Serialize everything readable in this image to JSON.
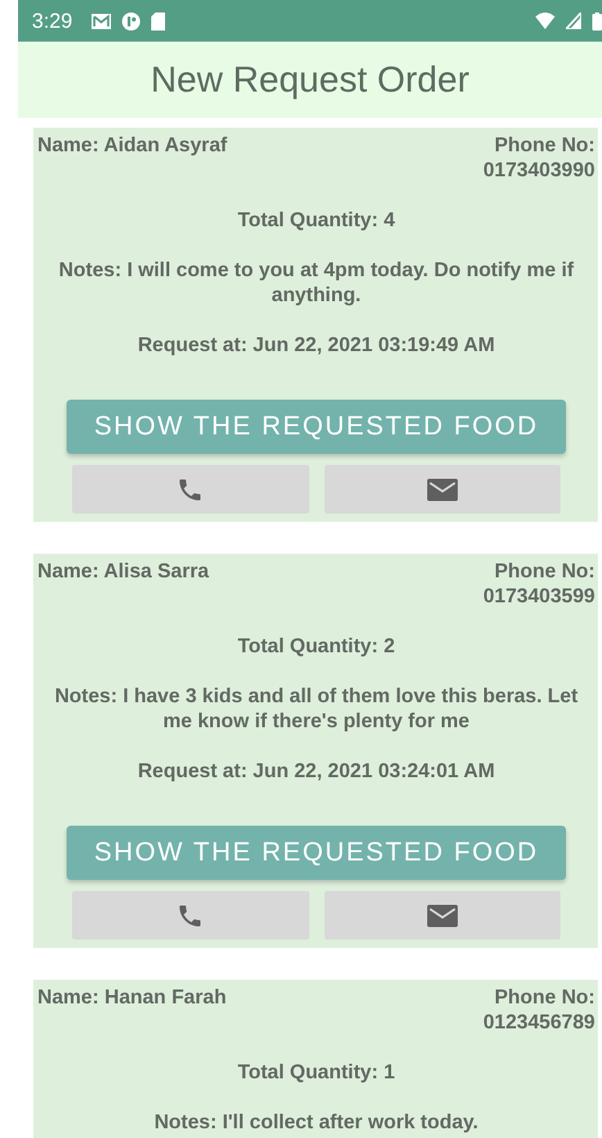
{
  "status_bar": {
    "time": "3:29"
  },
  "header": {
    "title": "New Request Order"
  },
  "requests": [
    {
      "name": "Name: Aidan Asyraf",
      "phone_label": "Phone No:",
      "phone": "0173403990",
      "quantity": "Total Quantity: 4",
      "notes": "Notes: I will come to you at 4pm today. Do notify me if anything.",
      "requested_at": "Request at: Jun 22, 2021 03:19:49 AM",
      "button": "SHOW THE REQUESTED FOOD"
    },
    {
      "name": "Name: Alisa Sarra",
      "phone_label": "Phone No:",
      "phone": "0173403599",
      "quantity": "Total Quantity: 2",
      "notes": "Notes: I have 3 kids and all of them love this beras. Let me know if there's plenty for me",
      "requested_at": "Request at: Jun 22, 2021 03:24:01 AM",
      "button": "SHOW THE REQUESTED FOOD"
    },
    {
      "name": "Name: Hanan Farah",
      "phone_label": "Phone No:",
      "phone": "0123456789",
      "quantity": "Total Quantity: 1",
      "notes": "Notes: I'll collect after work today."
    }
  ]
}
